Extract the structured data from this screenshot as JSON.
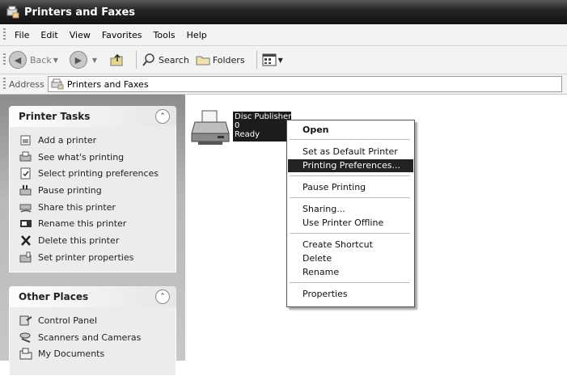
{
  "window": {
    "title": "Printers and Faxes"
  },
  "menubar": {
    "items": [
      "File",
      "Edit",
      "View",
      "Favorites",
      "Tools",
      "Help"
    ]
  },
  "toolbar": {
    "back_label": "Back",
    "search_label": "Search",
    "folders_label": "Folders"
  },
  "address": {
    "label": "Address",
    "value": "Printers and Faxes"
  },
  "printer_tasks": {
    "title": "Printer Tasks",
    "items": [
      {
        "label": "Add a printer",
        "icon": "add-printer-icon"
      },
      {
        "label": "See what's printing",
        "icon": "print-queue-icon"
      },
      {
        "label": "Select printing preferences",
        "icon": "preferences-icon"
      },
      {
        "label": "Pause printing",
        "icon": "pause-printer-icon"
      },
      {
        "label": "Share this printer",
        "icon": "share-printer-icon"
      },
      {
        "label": "Rename this printer",
        "icon": "rename-icon"
      },
      {
        "label": "Delete this printer",
        "icon": "delete-x-icon"
      },
      {
        "label": "Set printer properties",
        "icon": "properties-icon"
      }
    ]
  },
  "other_places": {
    "title": "Other Places",
    "items": [
      {
        "label": "Control Panel",
        "icon": "control-panel-icon"
      },
      {
        "label": "Scanners and Cameras",
        "icon": "scanner-icon"
      },
      {
        "label": "My Documents",
        "icon": "documents-folder-icon"
      }
    ]
  },
  "printer": {
    "name": "Disc Publisher XRP",
    "jobs": "0",
    "status": "Ready"
  },
  "context_menu": {
    "items": [
      {
        "label": "Open",
        "bold": true
      },
      {
        "label": "Set as Default Printer"
      },
      {
        "label": "Printing Preferences...",
        "selected": true
      },
      {
        "label": "Pause Printing"
      },
      {
        "label": "Sharing..."
      },
      {
        "label": "Use Printer Offline"
      },
      {
        "label": "Create Shortcut"
      },
      {
        "label": "Delete"
      },
      {
        "label": "Rename"
      },
      {
        "label": "Properties"
      }
    ]
  }
}
